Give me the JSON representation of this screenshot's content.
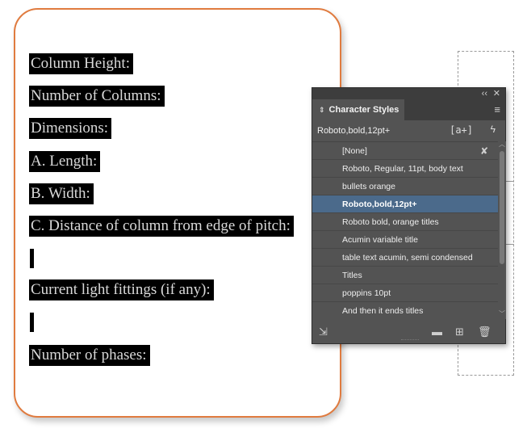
{
  "document": {
    "lines": [
      "Column Height: ",
      "Number of Columns: ",
      "Dimensions:",
      "A. Length: ",
      "B. Width: ",
      "C. Distance of column from edge of pitch:",
      "Current light fittings (if any):",
      "Number of phases:"
    ]
  },
  "panel": {
    "tab_label": "Character Styles",
    "current_style": "Roboto,bold,12pt+",
    "new_style_icon": "[a+]",
    "items": [
      "[None]",
      "Roboto, Regular, 11pt, body text",
      "bullets orange",
      "Roboto,bold,12pt+",
      "Roboto bold, orange titles",
      "Acumin variable title",
      "table text acumin, semi condensed",
      "Titles",
      "poppins 10pt",
      "And then it ends titles"
    ],
    "selected_index": 3,
    "icons": {
      "collapse": "double-chevron-icon",
      "close": "close-icon",
      "menu": "menu-icon",
      "quick_apply": "lightning-icon",
      "clear_override": "pen-cross-icon",
      "load_styles": "load-styles-icon",
      "new_group": "folder-icon",
      "new_style": "new-style-icon",
      "delete": "trash-icon"
    },
    "colors": {
      "panel_bg": "#535353",
      "selected_bg": "#4b6a8b",
      "frame_border": "#e07b3f"
    }
  }
}
